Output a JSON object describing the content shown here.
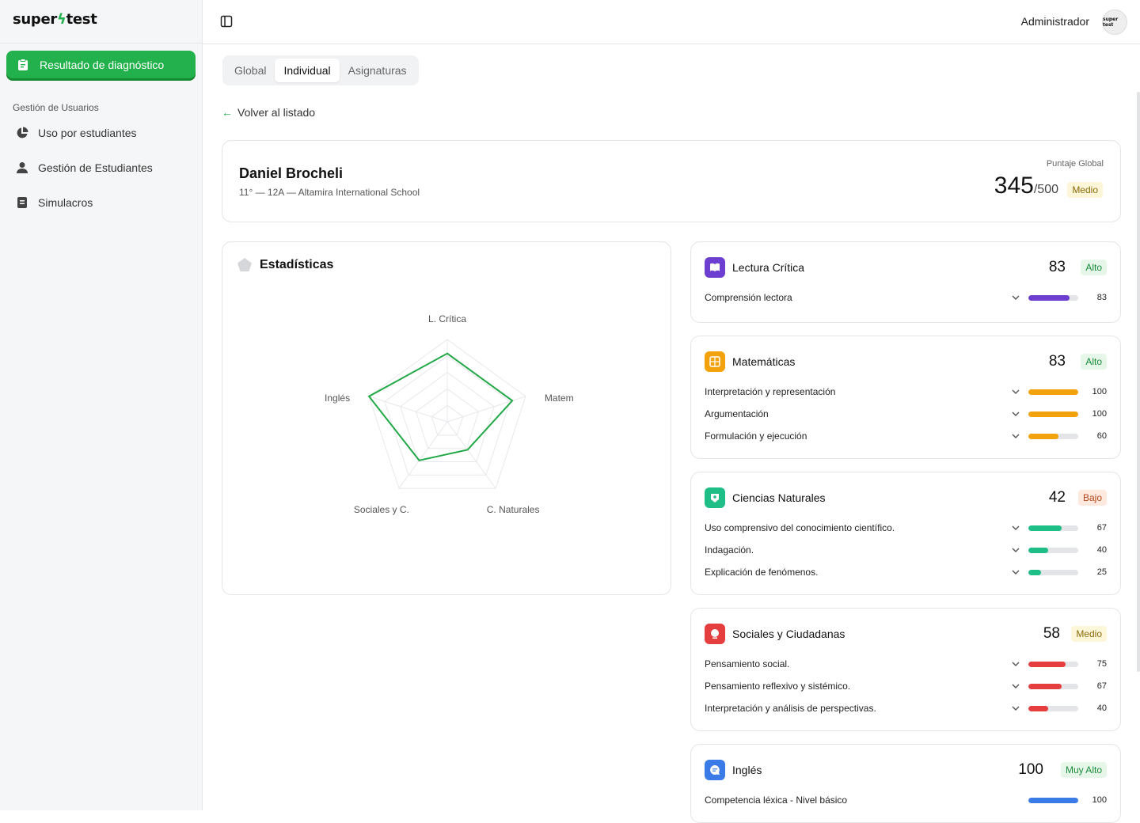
{
  "app": {
    "logo_left": "super",
    "logo_bolt": "ϟ",
    "logo_right": "test",
    "avatar_text": "super test"
  },
  "sidebar": {
    "active_item": "Resultado de diagnóstico",
    "section_title": "Gestión de Usuarios",
    "items": [
      {
        "label": "Uso por estudiantes",
        "icon": "pie-chart-icon"
      },
      {
        "label": "Gestión de Estudiantes",
        "icon": "user-icon"
      },
      {
        "label": "Simulacros",
        "icon": "document-icon"
      }
    ]
  },
  "header": {
    "user": "Administrador"
  },
  "tabs": [
    {
      "label": "Global"
    },
    {
      "label": "Individual",
      "active": true
    },
    {
      "label": "Asignaturas"
    }
  ],
  "back_label": "Volver al listado",
  "student": {
    "name": "Daniel Brocheli",
    "meta": "11° — 12A — Altamira International School",
    "score_label": "Puntaje Global",
    "score": "345",
    "score_max": "/500",
    "level": "Medio"
  },
  "stats": {
    "title": "Estadísticas",
    "chart_data": {
      "type": "radar",
      "axes": [
        "L. Crítica",
        "Matem",
        "C. Naturales",
        "Sociales y C.",
        "Inglés"
      ],
      "values": [
        83,
        83,
        42,
        58,
        100
      ],
      "range": [
        0,
        100
      ]
    }
  },
  "subjects": [
    {
      "name": "Lectura Crítica",
      "score": "83",
      "level": "Alto",
      "level_class": "b-alto",
      "color": "#6d3fd0",
      "icon": "book-icon",
      "rows": [
        {
          "label": "Comprensión lectora",
          "value": 83,
          "value_text": "83"
        }
      ]
    },
    {
      "name": "Matemáticas",
      "score": "83",
      "level": "Alto",
      "level_class": "b-alto",
      "color": "#f2a20c",
      "icon": "calculator-icon",
      "rows": [
        {
          "label": "Interpretación y representación",
          "value": 100,
          "value_text": "100"
        },
        {
          "label": "Argumentación",
          "value": 100,
          "value_text": "100"
        },
        {
          "label": "Formulación y ejecución",
          "value": 60,
          "value_text": "60"
        }
      ]
    },
    {
      "name": "Ciencias Naturales",
      "score": "42",
      "level": "Bajo",
      "level_class": "b-bajo",
      "color": "#1fbe87",
      "icon": "leaf-icon",
      "rows": [
        {
          "label": "Uso comprensivo del conocimiento científico.",
          "value": 67,
          "value_text": "67"
        },
        {
          "label": "Indagación.",
          "value": 40,
          "value_text": "40"
        },
        {
          "label": "Explicación de fenómenos.",
          "value": 25,
          "value_text": "25"
        }
      ]
    },
    {
      "name": "Sociales y Ciudadanas",
      "score": "58",
      "level": "Medio",
      "level_class": "b-medio",
      "color": "#e53e3e",
      "icon": "globe-icon",
      "rows": [
        {
          "label": "Pensamiento social.",
          "value": 75,
          "value_text": "75"
        },
        {
          "label": "Pensamiento reflexivo y sistémico.",
          "value": 67,
          "value_text": "67"
        },
        {
          "label": "Interpretación y análisis de perspectivas.",
          "value": 40,
          "value_text": "40"
        }
      ]
    },
    {
      "name": "Inglés",
      "score": "100",
      "level": "Muy Alto",
      "level_class": "b-alto",
      "color": "#3b7be8",
      "icon": "chat-icon",
      "rows": [
        {
          "label": "Competencia léxica - Nivel básico",
          "value": 100,
          "value_text": "100"
        }
      ]
    }
  ]
}
